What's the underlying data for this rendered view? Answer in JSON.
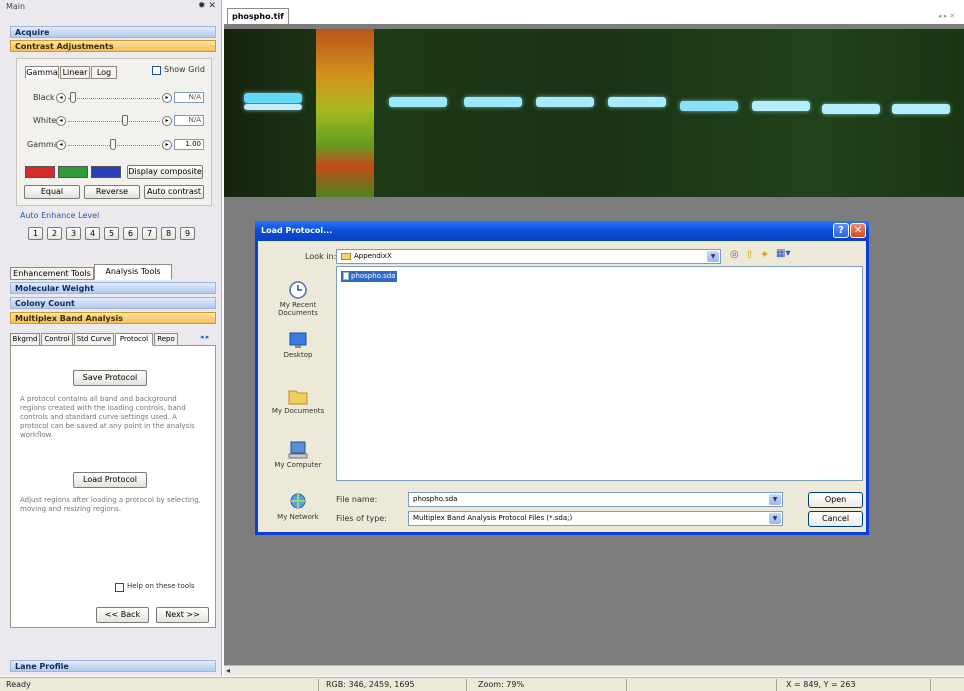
{
  "left_panel": {
    "title": "Main",
    "controls": "✹ ✕",
    "sections": {
      "acquire": "Acquire",
      "contrast": "Contrast Adjustments"
    },
    "contrast_tabs": [
      "Gamma",
      "Linear",
      "Log"
    ],
    "show_grid": "Show Grid",
    "sliders": [
      {
        "label": "Black",
        "value": "N/A"
      },
      {
        "label": "White",
        "value": "N/A"
      },
      {
        "label": "Gamma",
        "value": "1.00"
      }
    ],
    "display_composite": "Display composite",
    "equal": "Equal",
    "reverse": "Reverse",
    "auto_contrast": "Auto contrast",
    "auto_enhance_label": "Auto Enhance Level",
    "levels": [
      "1",
      "2",
      "3",
      "4",
      "5",
      "6",
      "7",
      "8",
      "9"
    ],
    "tool_tabs": [
      "Enhancement Tools",
      "Analysis Tools"
    ],
    "analysis_sections": [
      "Molecular Weight",
      "Colony Count",
      "Multiplex Band Analysis"
    ],
    "mba_tabs": [
      "Bkgrnd",
      "Control",
      "Std Curve",
      "Protocol",
      "Repo"
    ],
    "save_protocol": "Save Protocol",
    "save_desc": "A protocol contains all band and background regions created with the loading controls, band controls and standard curve settings used. A protocol can be saved at any point in the analysis workflow.",
    "load_protocol": "Load Protocol",
    "load_desc": "Adjust regions after loading a protocol by selecting, moving and resizing regions.",
    "help": "Help on these tools",
    "back": "<< Back",
    "next": "Next >>",
    "lane_profile": "Lane Profile"
  },
  "document": {
    "tab": "phospho.tif"
  },
  "dialog": {
    "title": "Load Protocol...",
    "look_in_label": "Look in:",
    "look_in_value": "AppendixX",
    "places": [
      "My Recent Documents",
      "Desktop",
      "My Documents",
      "My Computer",
      "My Network"
    ],
    "files": [
      "phospho.sda"
    ],
    "file_name_label": "File name:",
    "file_name_value": "phospho.sda",
    "file_type_label": "Files of type:",
    "file_type_value": "Multiplex Band Analysis Protocol Files (*.sda;)",
    "open": "Open",
    "cancel": "Cancel"
  },
  "status": {
    "ready": "Ready",
    "rgb": "RGB: 346, 2459, 1695",
    "zoom": "Zoom: 79%",
    "coords": "X = 849, Y = 263"
  },
  "colors": {
    "accent": "#0a4fd9",
    "orange_header": "#f5bf59",
    "blue_header": "#b3c9ee"
  }
}
